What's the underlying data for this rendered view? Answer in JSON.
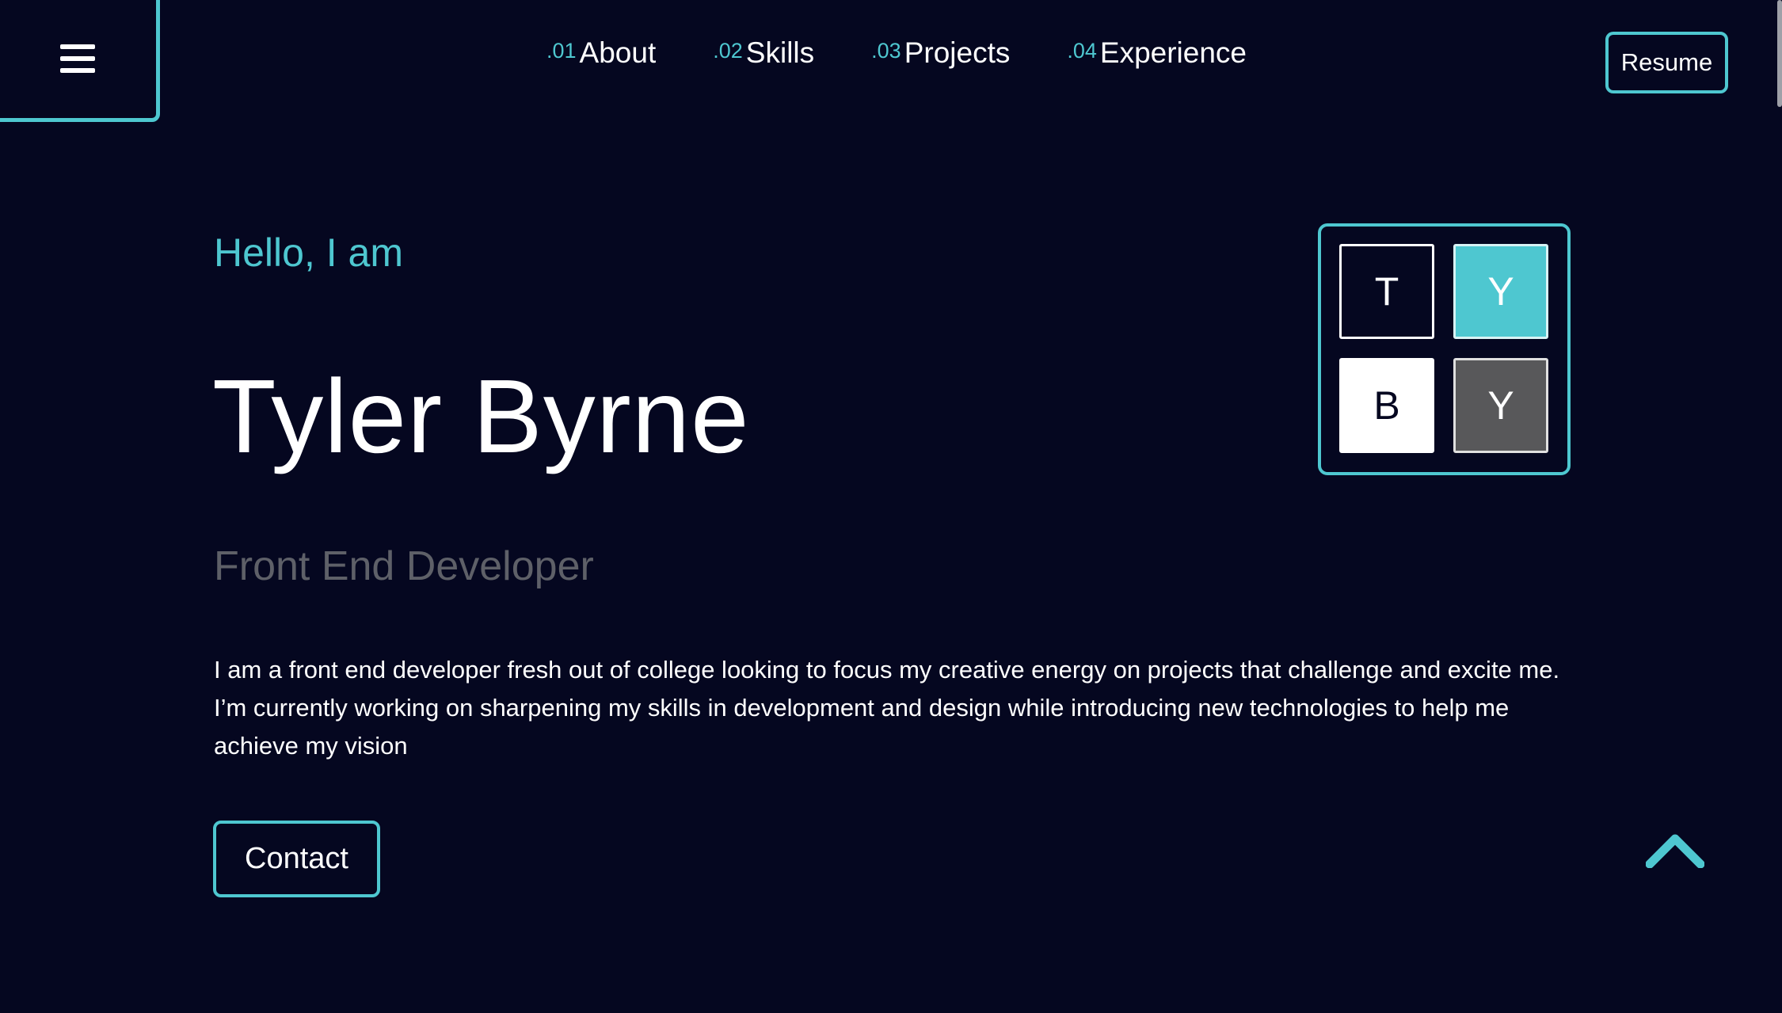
{
  "nav": {
    "items": [
      {
        "num": ".01",
        "label": "About"
      },
      {
        "num": ".02",
        "label": "Skills"
      },
      {
        "num": ".03",
        "label": "Projects"
      },
      {
        "num": ".04",
        "label": "Experience"
      }
    ],
    "resume_label": "Resume",
    "menu_icon": "hamburger-icon"
  },
  "hero": {
    "greeting": "Hello, I am",
    "name": "Tyler Byrne",
    "role": "Front End Developer",
    "bio": "I am a front end developer fresh out of college looking to focus my creative energy on projects that challenge and excite me. I’m currently working on sharpening my skills in development and design while introducing new technologies to help me achieve my vision",
    "contact_label": "Contact"
  },
  "logo": {
    "tiles": [
      "T",
      "Y",
      "B",
      "Y"
    ]
  },
  "scroll_top_icon": "chevron-up-icon",
  "colors": {
    "background": "#050720",
    "accent": "#4ec7d0",
    "muted": "#5e6068",
    "text": "#ffffff"
  }
}
